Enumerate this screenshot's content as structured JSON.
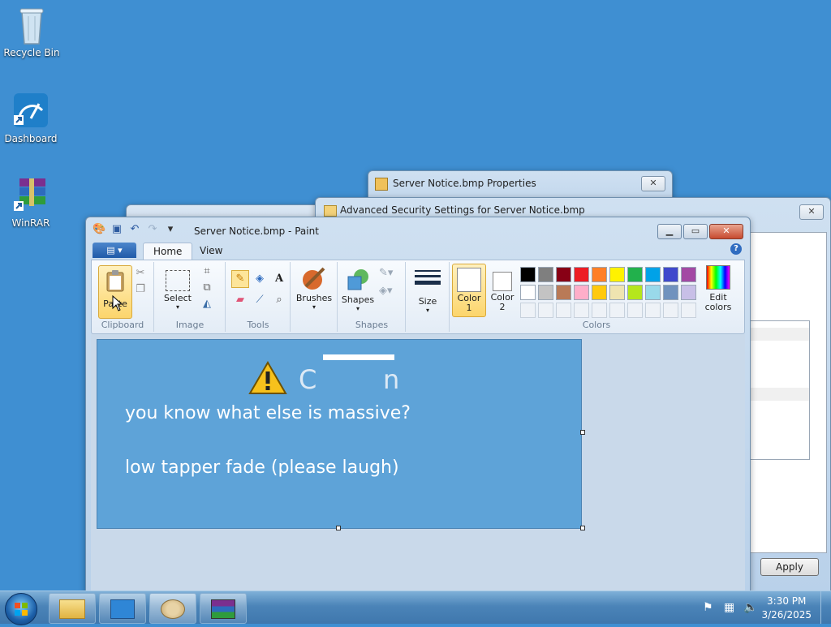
{
  "desktop": {
    "icons": [
      {
        "label": "Recycle Bin"
      },
      {
        "label": "Dashboard"
      },
      {
        "label": "WinRAR"
      }
    ]
  },
  "properties_window": {
    "title": "Server Notice.bmp Properties",
    "close_label": "✕"
  },
  "security_window": {
    "title": "Advanced Security Settings for Server Notice.bmp",
    "close_label": "✕",
    "apply_label": "Apply"
  },
  "paint": {
    "title": "Server Notice.bmp - Paint",
    "tabs": [
      {
        "label": "Home"
      },
      {
        "label": "View"
      }
    ],
    "groups": {
      "clipboard": {
        "label": "Clipboard",
        "paste_label": "Paste"
      },
      "image": {
        "label": "Image",
        "select_label": "Select"
      },
      "tools": {
        "label": "Tools"
      },
      "brushes_label": "Brushes",
      "shapes": {
        "label": "Shapes",
        "button_label": "Shapes"
      },
      "size_label": "Size",
      "colors": {
        "label": "Colors",
        "color1_label": "Color 1",
        "color2_label": "Color 2",
        "edit_label": "Edit colors",
        "palette_row1": [
          "#000000",
          "#7f7f7f",
          "#880015",
          "#ed1c24",
          "#ff7f27",
          "#fff200",
          "#22b14c",
          "#00a2e8",
          "#3f48cc",
          "#a349a4"
        ],
        "palette_row2": [
          "#ffffff",
          "#c3c3c3",
          "#b97a57",
          "#ffaec9",
          "#ffc90e",
          "#efe4b0",
          "#b5e61d",
          "#99d9ea",
          "#7092be",
          "#c8bfe7"
        ]
      }
    },
    "canvas": {
      "line1": "you know what else is massive?",
      "line2": "low tapper fade (please laugh)",
      "heading_partial_left": "C",
      "heading_partial_right": "n"
    }
  },
  "taskbar": {
    "time": "3:30 PM",
    "date": "3/26/2025"
  }
}
